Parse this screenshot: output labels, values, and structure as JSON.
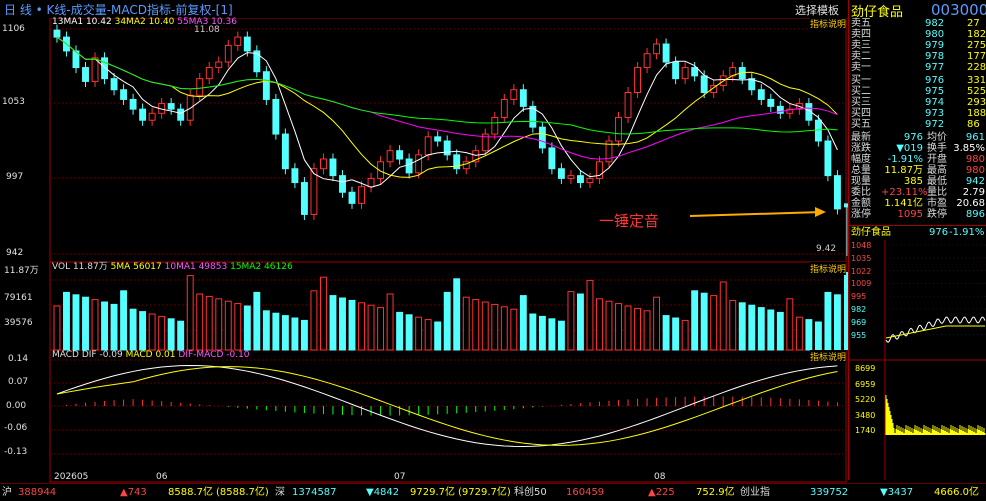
{
  "topbar": {
    "title": "日 线 • K线-成交量-MACD指标-前复权-[1]",
    "template_button": "选择模板",
    "stock_name": "劲仔食品",
    "stock_code": "003000"
  },
  "kline": {
    "ma_legend": [
      "13MA1 10.42",
      "34MA2 10.40",
      "55MA3 10.36"
    ],
    "help": "指标说明",
    "y_ticks": [
      "1106",
      "1053",
      "997",
      "942"
    ],
    "high_label": "11.08",
    "low_label": "9.42",
    "annotation": "一锤定音"
  },
  "volume": {
    "legend": [
      "VOL 11.87万",
      "5MA 56017",
      "10MA1 49853",
      "15MA2 46126"
    ],
    "help": "指标说明",
    "y_ticks": [
      "11.87万",
      "79161",
      "39576"
    ]
  },
  "macd": {
    "legend": [
      "MACD DIF -0.09",
      "MACD 0.01",
      "DIF-MACD -0.10"
    ],
    "help": "指标说明",
    "y_ticks": [
      "0.14",
      "0.07",
      "0.00",
      "-0.06",
      "-0.13"
    ],
    "x_ticks": [
      "202605",
      "06",
      "07",
      "08"
    ]
  },
  "quote": {
    "asks": [
      {
        "label": "卖五",
        "price": "982",
        "vol": "27"
      },
      {
        "label": "卖四",
        "price": "980",
        "vol": "182"
      },
      {
        "label": "卖三",
        "price": "979",
        "vol": "275"
      },
      {
        "label": "卖二",
        "price": "978",
        "vol": "177"
      },
      {
        "label": "卖一",
        "price": "977",
        "vol": "228"
      }
    ],
    "bids": [
      {
        "label": "买一",
        "price": "976",
        "vol": "331"
      },
      {
        "label": "买二",
        "price": "975",
        "vol": "525"
      },
      {
        "label": "买三",
        "price": "974",
        "vol": "293"
      },
      {
        "label": "买四",
        "price": "973",
        "vol": "188"
      },
      {
        "label": "买五",
        "price": "972",
        "vol": "86"
      }
    ],
    "stats": [
      {
        "l1": "最新",
        "v1": "976",
        "l2": "均价",
        "v2": "961"
      },
      {
        "l1": "涨跌",
        "v1": "▼019",
        "l2": "换手",
        "v2": "3.85%"
      },
      {
        "l1": "幅度",
        "v1": "-1.91%",
        "l2": "开盘",
        "v2": "980"
      },
      {
        "l1": "总量",
        "v1": "11.87万",
        "l2": "最高",
        "v2": "980"
      },
      {
        "l1": "现量",
        "v1": "385",
        "l2": "最低",
        "v2": "942"
      },
      {
        "l1": "委比",
        "v1": "+23.11%",
        "l2": "量比",
        "v2": "2.79"
      },
      {
        "l1": "金额",
        "v1": "1.141亿",
        "l2": "市盈",
        "v2": "20.68"
      },
      {
        "l1": "涨停",
        "v1": "1095",
        "l2": "跌停",
        "v2": "896"
      }
    ],
    "mini_title": "劲仔食品",
    "mini_price": "976",
    "mini_pct": "-1.91%",
    "mini_y": [
      "1048",
      "1035",
      "1022",
      "1009",
      "995",
      "982",
      "969",
      "955"
    ],
    "mini_vol_y": [
      "8699",
      "6959",
      "5220",
      "3480",
      "1740"
    ]
  },
  "bottom": {
    "items": [
      {
        "name": "沪",
        "value": "388944",
        "chg": "▲743",
        "idx": "8588.7亿",
        "idx2": "(8588.7亿)"
      },
      {
        "name": "深",
        "value": "1374587",
        "chg": "▼4842",
        "idx": "9729.7亿",
        "idx2": "(9729.7亿)"
      },
      {
        "name": "科创50",
        "value": "160459",
        "chg": "▲225",
        "idx": "752.9亿",
        "idx2": ""
      },
      {
        "name": "创业指",
        "value": "339752",
        "chg": "▼3437",
        "idx": "4666.0亿",
        "idx2": ""
      }
    ]
  },
  "chart_data": {
    "type": "candlestick",
    "y_range": [
      9.42,
      11.08
    ],
    "colors": {
      "up": "#ff3232",
      "down": "#54ffff",
      "ma1": "#ffffff",
      "ma2": "#ffff00",
      "ma3": "#ff00ff",
      "ma4": "#00ff00"
    }
  }
}
